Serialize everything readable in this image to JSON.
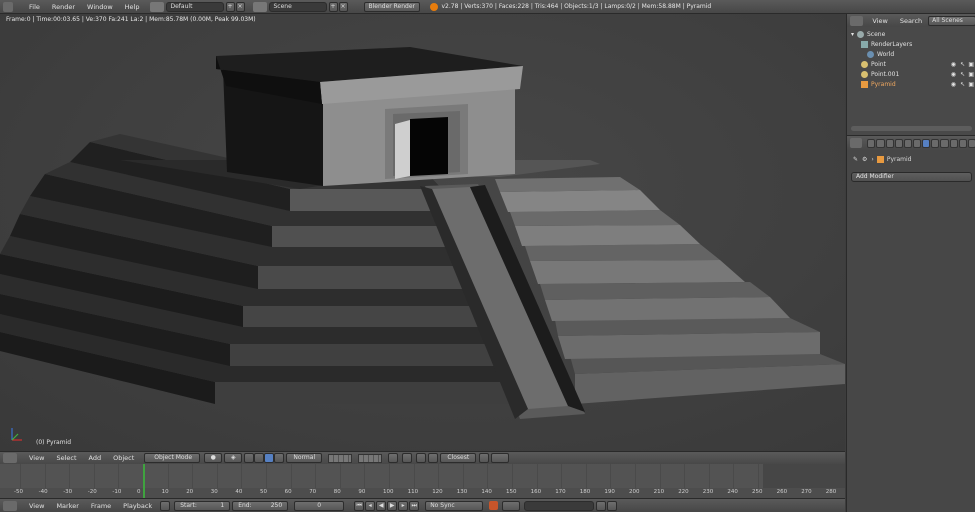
{
  "topbar": {
    "menus": [
      "File",
      "Render",
      "Window",
      "Help"
    ],
    "layout": "Default",
    "scene": "Scene",
    "engine": "Blender Render",
    "stats": "v2.78 | Verts:370 | Faces:228 | Tris:464 | Objects:1/3 | Lamps:0/2 | Mem:58.88M | Pyramid"
  },
  "viewport": {
    "info": "Frame:0 | Time:00:03.65 | Ve:370 Fa:241 La:2 | Mem:85.78M (0.00M, Peak 99.03M)",
    "object_label": "(0) Pyramid"
  },
  "viewport_header": {
    "menus": [
      "View",
      "Select",
      "Add",
      "Object"
    ],
    "mode": "Object Mode",
    "orientation": "Normal",
    "snap": "Closest"
  },
  "timeline": {
    "ticks": [
      "-50",
      "-40",
      "-30",
      "-20",
      "-10",
      "0",
      "10",
      "20",
      "30",
      "40",
      "50",
      "60",
      "70",
      "80",
      "90",
      "100",
      "110",
      "120",
      "130",
      "140",
      "150",
      "160",
      "170",
      "180",
      "190",
      "200",
      "210",
      "220",
      "230",
      "240",
      "250",
      "260",
      "270",
      "280"
    ]
  },
  "bottombar": {
    "menus": [
      "View",
      "Marker",
      "Frame",
      "Playback"
    ],
    "start_label": "Start:",
    "start_value": "1",
    "end_label": "End:",
    "end_value": "250",
    "current_frame": "0",
    "sync": "No Sync"
  },
  "outliner": {
    "menus": [
      "View",
      "Search"
    ],
    "filter": "All Scenes",
    "items": [
      "Scene",
      "RenderLayers",
      "World",
      "Point",
      "Point.001",
      "Pyramid"
    ]
  },
  "properties": {
    "object_name": "Pyramid",
    "add_modifier": "Add Modifier"
  },
  "colors": {
    "timeline_current": "#3fa33f",
    "active_tab": "#5680c2"
  }
}
